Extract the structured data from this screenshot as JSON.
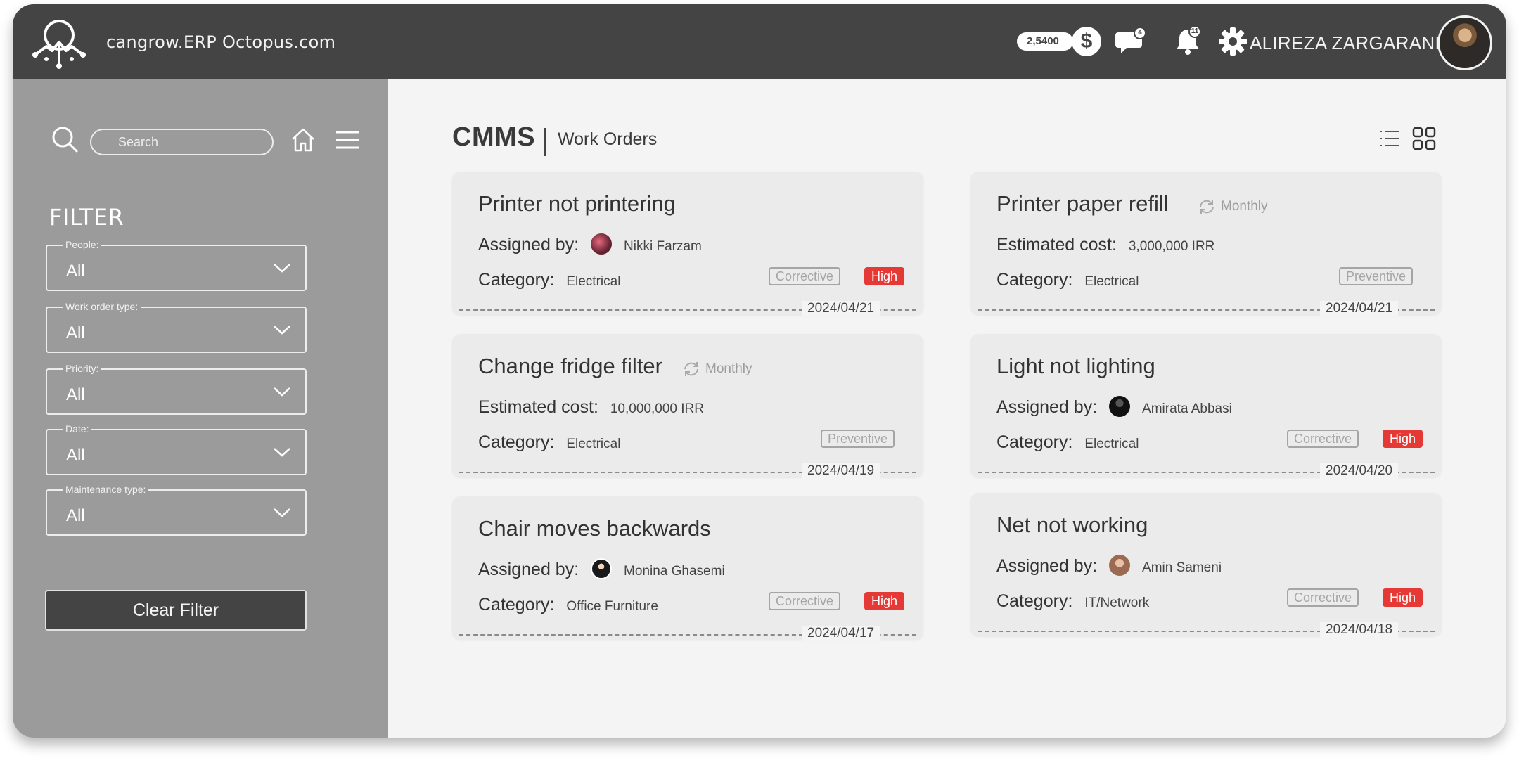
{
  "header": {
    "app_title": "cangrow.ERP Octopus.com",
    "balance": "2,5400",
    "currency_symbol": "$",
    "messages_count": "4",
    "notifications_count": "11",
    "user_name": "ALIREZA ZARGARANI"
  },
  "sidebar": {
    "search_placeholder": "Search",
    "filter_title": "FILTER",
    "filters": [
      {
        "label": "People:",
        "value": "All"
      },
      {
        "label": "Work order type:",
        "value": "All"
      },
      {
        "label": "Priority:",
        "value": "All"
      },
      {
        "label": "Date:",
        "value": "All"
      },
      {
        "label": "Maintenance type:",
        "value": "All"
      }
    ],
    "clear_label": "Clear Filter"
  },
  "main": {
    "title": "CMMS",
    "subtitle": "Work Orders"
  },
  "cards": [
    {
      "title": "Printer not printering",
      "row1_label": "Assigned by:",
      "row1_value": "Nikki Farzam",
      "row2_label": "Category:",
      "row2_value": "Electrical",
      "type_tag": "Corrective",
      "priority_tag": "High",
      "date": "2024/04/21"
    },
    {
      "title": "Printer paper refill",
      "recurrence": "Monthly",
      "row1_label": "Estimated cost:",
      "row1_value": "3,000,000 IRR",
      "row2_label": "Category:",
      "row2_value": "Electrical",
      "type_tag": "Preventive",
      "date": "2024/04/21"
    },
    {
      "title": "Change fridge filter",
      "recurrence": "Monthly",
      "row1_label": "Estimated cost:",
      "row1_value": "10,000,000 IRR",
      "row2_label": "Category:",
      "row2_value": "Electrical",
      "type_tag": "Preventive",
      "date": "2024/04/19"
    },
    {
      "title": "Light not lighting",
      "row1_label": "Assigned by:",
      "row1_value": "Amirata Abbasi",
      "row2_label": "Category:",
      "row2_value": "Electrical",
      "type_tag": "Corrective",
      "priority_tag": "High",
      "date": "2024/04/20"
    },
    {
      "title": "Chair moves backwards",
      "row1_label": "Assigned by:",
      "row1_value": "Monina Ghasemi",
      "row2_label": "Category:",
      "row2_value": "Office Furniture",
      "type_tag": "Corrective",
      "priority_tag": "High",
      "date": "2024/04/17"
    },
    {
      "title": "Net not working",
      "row1_label": "Assigned by:",
      "row1_value": "Amin Sameni",
      "row2_label": "Category:",
      "row2_value": "IT/Network",
      "type_tag": "Corrective",
      "priority_tag": "High",
      "date": "2024/04/18"
    }
  ],
  "colors": {
    "header_bg": "#444444",
    "sidebar_bg": "#9b9b9b",
    "priority_high": "#e53935"
  }
}
